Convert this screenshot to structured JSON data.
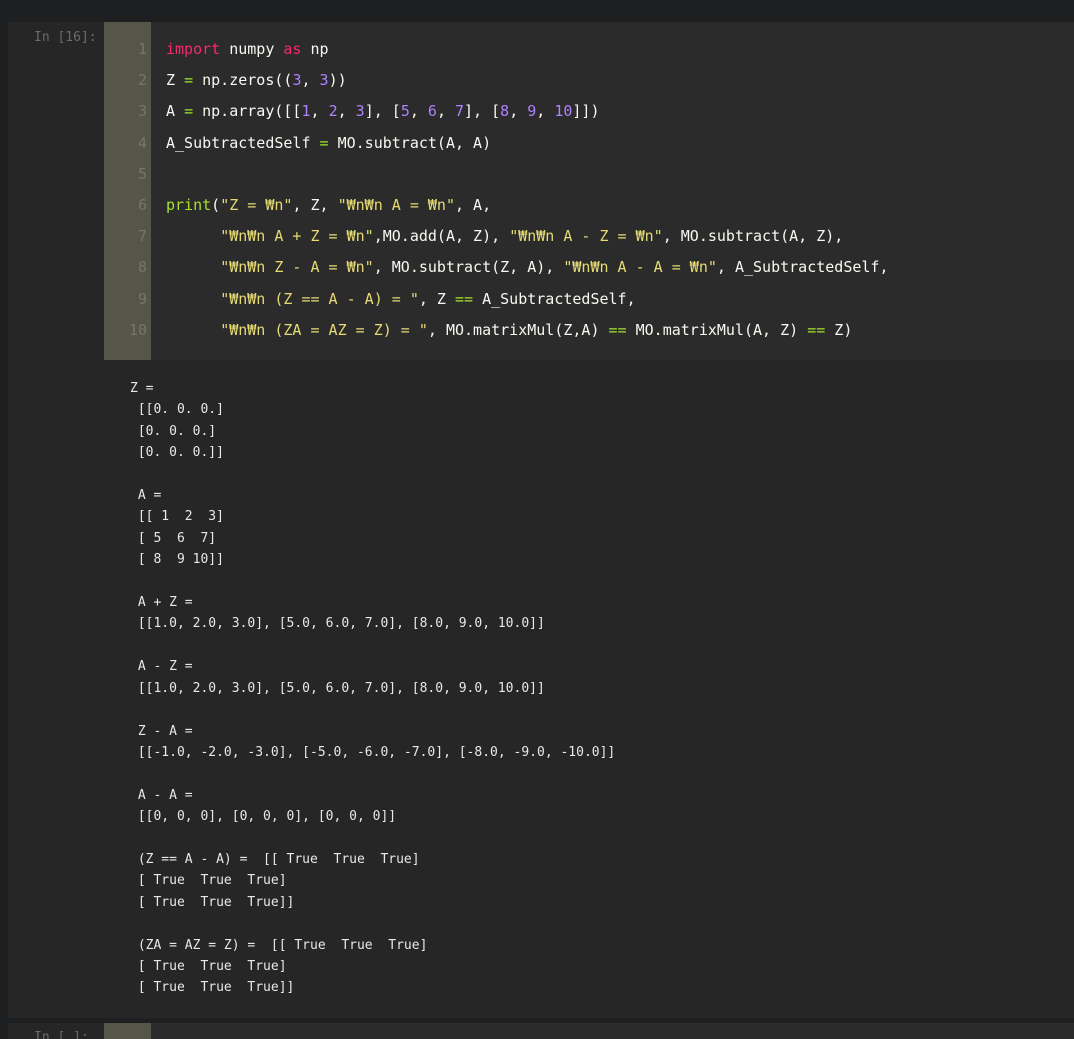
{
  "cell": {
    "prompt": "In [16]:",
    "lines": [
      {
        "n": "1",
        "tokens": [
          [
            "kw",
            "import"
          ],
          [
            "pl",
            " numpy "
          ],
          [
            "kw",
            "as"
          ],
          [
            "pl",
            " np"
          ]
        ]
      },
      {
        "n": "2",
        "tokens": [
          [
            "pl",
            "Z "
          ],
          [
            "op",
            "="
          ],
          [
            "pl",
            " np.zeros(("
          ],
          [
            "nm",
            "3"
          ],
          [
            "pl",
            ", "
          ],
          [
            "nm",
            "3"
          ],
          [
            "pl",
            "))"
          ]
        ]
      },
      {
        "n": "3",
        "tokens": [
          [
            "pl",
            "A "
          ],
          [
            "op",
            "="
          ],
          [
            "pl",
            " np.array([["
          ],
          [
            "nm",
            "1"
          ],
          [
            "pl",
            ", "
          ],
          [
            "nm",
            "2"
          ],
          [
            "pl",
            ", "
          ],
          [
            "nm",
            "3"
          ],
          [
            "pl",
            "], ["
          ],
          [
            "nm",
            "5"
          ],
          [
            "pl",
            ", "
          ],
          [
            "nm",
            "6"
          ],
          [
            "pl",
            ", "
          ],
          [
            "nm",
            "7"
          ],
          [
            "pl",
            "], ["
          ],
          [
            "nm",
            "8"
          ],
          [
            "pl",
            ", "
          ],
          [
            "nm",
            "9"
          ],
          [
            "pl",
            ", "
          ],
          [
            "nm",
            "10"
          ],
          [
            "pl",
            "]])"
          ]
        ]
      },
      {
        "n": "4",
        "tokens": [
          [
            "pl",
            "A_SubtractedSelf "
          ],
          [
            "op",
            "="
          ],
          [
            "pl",
            " MO.subtract(A, A)"
          ]
        ]
      },
      {
        "n": "5",
        "tokens": []
      },
      {
        "n": "6",
        "tokens": [
          [
            "fn",
            "print"
          ],
          [
            "pl",
            "("
          ],
          [
            "st",
            "\"Z = ₩n\""
          ],
          [
            "pl",
            ", Z, "
          ],
          [
            "st",
            "\"₩n₩n A = ₩n\""
          ],
          [
            "pl",
            ", A,"
          ]
        ]
      },
      {
        "n": "7",
        "tokens": [
          [
            "pl",
            "      "
          ],
          [
            "st",
            "\"₩n₩n A + Z = ₩n\""
          ],
          [
            "pl",
            ",MO.add(A, Z), "
          ],
          [
            "st",
            "\"₩n₩n A - Z = ₩n\""
          ],
          [
            "pl",
            ", MO.subtract(A, Z),"
          ]
        ]
      },
      {
        "n": "8",
        "tokens": [
          [
            "pl",
            "      "
          ],
          [
            "st",
            "\"₩n₩n Z - A = ₩n\""
          ],
          [
            "pl",
            ", MO.subtract(Z, A), "
          ],
          [
            "st",
            "\"₩n₩n A - A = ₩n\""
          ],
          [
            "pl",
            ", A_SubtractedSelf,"
          ]
        ]
      },
      {
        "n": "9",
        "tokens": [
          [
            "pl",
            "      "
          ],
          [
            "st",
            "\"₩n₩n (Z == A - A) = \""
          ],
          [
            "pl",
            ", Z "
          ],
          [
            "op",
            "=="
          ],
          [
            "pl",
            " A_SubtractedSelf,"
          ]
        ]
      },
      {
        "n": "10",
        "tokens": [
          [
            "pl",
            "      "
          ],
          [
            "st",
            "\"₩n₩n (ZA = AZ = Z) = \""
          ],
          [
            "pl",
            ", MO.matrixMul(Z,A) "
          ],
          [
            "op",
            "=="
          ],
          [
            "pl",
            " MO.matrixMul(A, Z) "
          ],
          [
            "op",
            "=="
          ],
          [
            "pl",
            " Z)"
          ]
        ]
      }
    ]
  },
  "output": "Z = \n [[0. 0. 0.]\n [0. 0. 0.]\n [0. 0. 0.]] \n\n A = \n [[ 1  2  3]\n [ 5  6  7]\n [ 8  9 10]] \n\n A + Z = \n [[1.0, 2.0, 3.0], [5.0, 6.0, 7.0], [8.0, 9.0, 10.0]] \n\n A - Z = \n [[1.0, 2.0, 3.0], [5.0, 6.0, 7.0], [8.0, 9.0, 10.0]] \n\n Z - A = \n [[-1.0, -2.0, -3.0], [-5.0, -6.0, -7.0], [-8.0, -9.0, -10.0]] \n\n A - A = \n [[0, 0, 0], [0, 0, 0], [0, 0, 0]] \n\n (Z == A - A) =  [[ True  True  True]\n [ True  True  True]\n [ True  True  True]] \n\n (ZA = AZ = Z) =  [[ True  True  True]\n [ True  True  True]\n [ True  True  True]]",
  "next_cell": {
    "prompt": "In [ ]:"
  },
  "colors": {
    "background": "#1d1f20",
    "cell": "#262626",
    "gutter": "#555548",
    "keyword": "#f92672",
    "number": "#ae81ff",
    "string": "#e6db74",
    "function": "#a6e22e"
  }
}
